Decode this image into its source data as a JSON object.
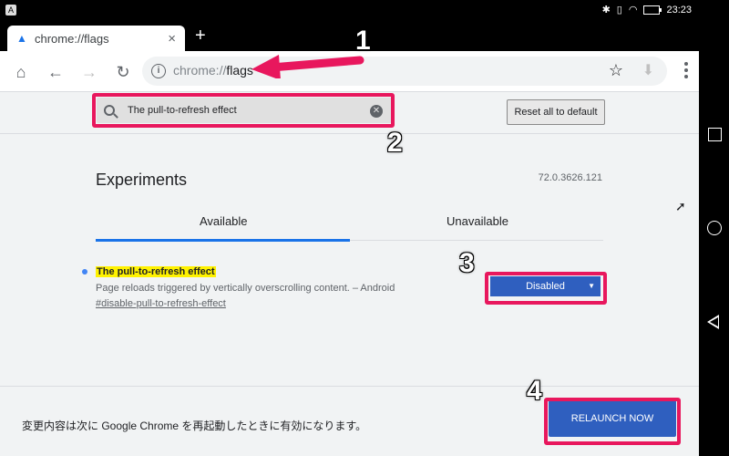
{
  "statusbar": {
    "time": "23:23",
    "icons": [
      "bluetooth-icon",
      "vibrate-icon",
      "wifi-icon",
      "battery-icon"
    ]
  },
  "tab": {
    "title": "chrome://flags",
    "favicon": "flask-icon",
    "close": "×",
    "new_tab": "+"
  },
  "toolbar": {
    "url_prefix": "chrome://",
    "url_host": "flags",
    "info": "i"
  },
  "search": {
    "value": "The pull-to-refresh effect",
    "reset_label": "Reset all to default"
  },
  "experiments": {
    "title": "Experiments",
    "version": "72.0.3626.121",
    "tabs": [
      "Available",
      "Unavailable"
    ],
    "flag": {
      "name": "The pull-to-refresh effect",
      "description": "Page reloads triggered by vertically overscrolling content. – Android",
      "link": "#disable-pull-to-refresh-effect",
      "selected": "Disabled"
    }
  },
  "footer": {
    "message": "変更内容は次に Google Chrome を再起動したときに有効になります。",
    "relaunch_label": "RELAUNCH NOW"
  },
  "annotations": {
    "labels": [
      "1",
      "2",
      "3",
      "4"
    ],
    "color": "#e8175d"
  },
  "colors": {
    "accent": "#1a73e8",
    "button": "#2f5fbf",
    "highlight": "#fff200"
  }
}
